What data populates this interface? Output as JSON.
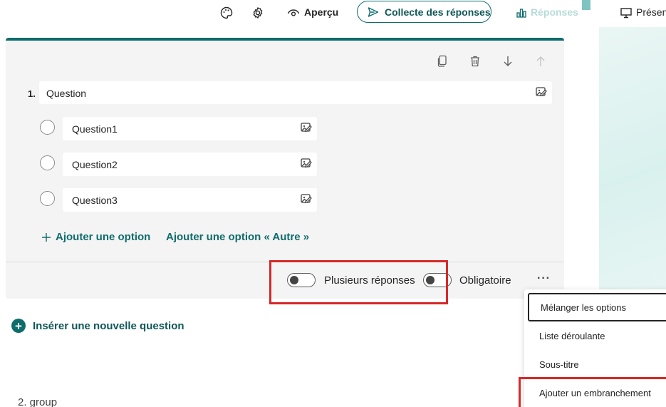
{
  "topbar": {
    "theme_icon": "palette-icon",
    "settings_icon": "gear-icon",
    "preview_label": "Aperçu",
    "collect_label": "Collecte des réponses",
    "responses_label": "Réponses",
    "present_label": "Présen"
  },
  "card": {
    "tools": [
      "copy-icon",
      "trash-icon",
      "arrow-down-icon",
      "arrow-up-icon"
    ],
    "question_number": "1.",
    "question_text": "Question",
    "options": [
      {
        "label": "Question1"
      },
      {
        "label": "Question2"
      },
      {
        "label": "Question3"
      }
    ],
    "add_option_label": "Ajouter une option",
    "add_other_label": "Ajouter une option « Autre »",
    "multiple_answers_label": "Plusieurs réponses",
    "multiple_answers_on": false,
    "required_label": "Obligatoire",
    "required_on": false,
    "more_label": "···"
  },
  "insert_question_label": "Insérer une nouvelle question",
  "next_question_text": "2. group",
  "menu": {
    "items": [
      {
        "label": "Mélanger les options"
      },
      {
        "label": "Liste déroulante"
      },
      {
        "label": "Sous-titre"
      },
      {
        "label": "Ajouter un embranchement"
      }
    ]
  },
  "colors": {
    "accent": "#0f6c6c",
    "highlight": "#d62828"
  }
}
